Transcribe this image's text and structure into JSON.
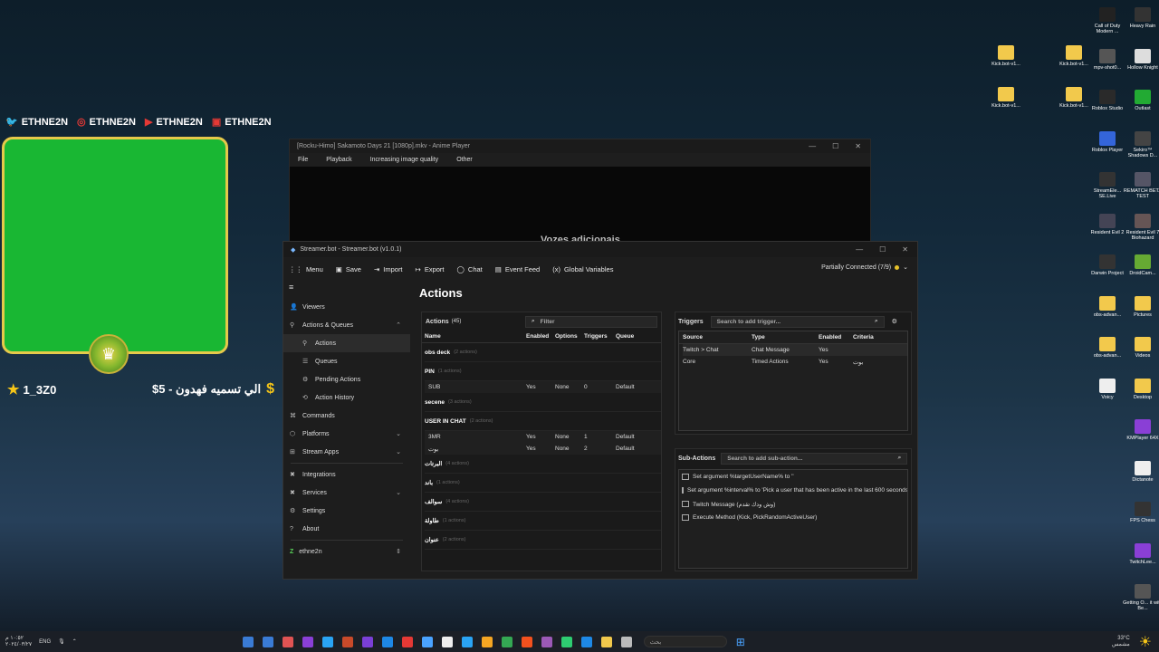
{
  "overlay": {
    "socials": [
      {
        "icon": "twitter-icon",
        "handle": "ETHNE2N",
        "color": "#e53935"
      },
      {
        "icon": "instagram-icon",
        "handle": "ETHNE2N",
        "color": "#e53935"
      },
      {
        "icon": "youtube-icon",
        "handle": "ETHNE2N",
        "color": "#e53935"
      },
      {
        "icon": "twitch-icon",
        "handle": "ETHNE2N",
        "color": "#e53935"
      }
    ],
    "stars_user": "1_3Z0",
    "donation_text": "الي تسميه فهدون - 5$",
    "cam_color": "#19b733"
  },
  "player": {
    "title": "[Rocku-Himo] Sakamoto Days 21 [1080p].mkv - Anime Player",
    "menu": [
      "File",
      "Playback",
      "Increasing image quality",
      "Other"
    ],
    "subtitle": "Vozes adicionais"
  },
  "streamerbot": {
    "title": "Streamer.bot - Streamer.bot (v1.0.1)",
    "toolbar": [
      "Menu",
      "Save",
      "Import",
      "Export",
      "Chat",
      "Event Feed",
      "Global Variables"
    ],
    "connection": "Partially Connected (7/9)",
    "sidebar": [
      {
        "label": "Viewers",
        "icon": "person-icon"
      },
      {
        "label": "Actions & Queues",
        "icon": "actions-icon",
        "expanded": true
      },
      {
        "label": "Actions",
        "icon": "actions-icon",
        "sub": true,
        "active": true
      },
      {
        "label": "Queues",
        "icon": "queue-icon",
        "sub": true
      },
      {
        "label": "Pending Actions",
        "icon": "pending-icon",
        "sub": true
      },
      {
        "label": "Action History",
        "icon": "history-icon",
        "sub": true
      },
      {
        "label": "Commands",
        "icon": "command-icon"
      },
      {
        "label": "Platforms",
        "icon": "platforms-icon",
        "chevron": true
      },
      {
        "label": "Stream Apps",
        "icon": "apps-icon",
        "chevron": true
      },
      {
        "label": "Integrations",
        "icon": "integrations-icon"
      },
      {
        "label": "Services",
        "icon": "services-icon",
        "chevron": true
      },
      {
        "label": "Settings",
        "icon": "gear-icon"
      },
      {
        "label": "About",
        "icon": "info-icon"
      }
    ],
    "user": "ethne2n",
    "heading": "Actions",
    "actions": {
      "label": "Actions",
      "count": "(45)",
      "filter_placeholder": "Filter",
      "columns": [
        "Name",
        "Enabled",
        "Options",
        "Triggers",
        "Queue"
      ],
      "rows": [
        {
          "type": "group",
          "name": "obs deck",
          "meta": "(2 actions)"
        },
        {
          "type": "group",
          "name": "PIN",
          "meta": "(1 actions)"
        },
        {
          "type": "row",
          "name": "SUB",
          "enabled": "Yes",
          "options": "None",
          "triggers": "0",
          "queue": "Default"
        },
        {
          "type": "group",
          "name": "secene",
          "meta": "(3 actions)"
        },
        {
          "type": "group",
          "name": "USER IN CHAT",
          "meta": "(2 actions)"
        },
        {
          "type": "row",
          "name": "3MR",
          "enabled": "Yes",
          "options": "None",
          "triggers": "1",
          "queue": "Default"
        },
        {
          "type": "row",
          "name": "بوت",
          "enabled": "Yes",
          "options": "None",
          "triggers": "2",
          "queue": "Default"
        },
        {
          "type": "group",
          "name": "البرتات",
          "meta": "(4 actions)"
        },
        {
          "type": "group",
          "name": "باند",
          "meta": "(1 actions)"
        },
        {
          "type": "group",
          "name": "سوالف",
          "meta": "(4 actions)"
        },
        {
          "type": "group",
          "name": "طاولة",
          "meta": "(1 actions)"
        },
        {
          "type": "group",
          "name": "عنوان",
          "meta": "(2 actions)"
        }
      ]
    },
    "triggers": {
      "label": "Triggers",
      "search_placeholder": "Search to add trigger...",
      "columns": [
        "Source",
        "Type",
        "Enabled",
        "Criteria"
      ],
      "rows": [
        {
          "source": "Twitch > Chat",
          "type": "Chat Message",
          "enabled": "Yes",
          "criteria": ""
        },
        {
          "source": "Core",
          "type": "Timed Actions",
          "enabled": "Yes",
          "criteria": "بوت"
        }
      ]
    },
    "subactions": {
      "label": "Sub-Actions",
      "search_placeholder": "Search to add sub-action...",
      "rows": [
        "Set argument %targetUserName% to ''",
        "Set argument %interval% to 'Pick a user that has been active in the last 600 seconds'",
        "Twitch Message (وش ودك تقدم)",
        "Execute Method (Kick, PickRandomActiveUser)"
      ]
    }
  },
  "desktop": {
    "icons_col1": [
      {
        "label": "Kick.bot-v1...",
        "color": "#f2c94c"
      },
      {
        "label": "Kick.bot-v1...",
        "color": "#f2c94c"
      }
    ],
    "icons_col2": [
      {
        "label": "Kick.bot-v1...",
        "color": "#f2c94c"
      },
      {
        "label": "Kick.bot-v1...",
        "color": "#f2c94c"
      }
    ],
    "icons_col3": [
      {
        "label": "Call of Duty Modern ...",
        "color": "#222"
      },
      {
        "label": "mpv-shot0...",
        "color": "#555"
      },
      {
        "label": "Roblox Studio",
        "color": "#2a2a2a"
      },
      {
        "label": "Roblox Player",
        "color": "#3465d9"
      },
      {
        "label": "StreamEle... SE.Live",
        "color": "#333"
      },
      {
        "label": "Resident Evil 2",
        "color": "#445"
      },
      {
        "label": "Darwin Project",
        "color": "#333"
      },
      {
        "label": "obs-advan...",
        "color": "#f2c94c"
      },
      {
        "label": "obs-advan...",
        "color": "#f2c94c"
      },
      {
        "label": "Voicy",
        "color": "#eee"
      }
    ],
    "icons_col4": [
      {
        "label": "Heavy Rain",
        "color": "#333"
      },
      {
        "label": "Hollow Knight",
        "color": "#ddd"
      },
      {
        "label": "Outlast",
        "color": "#2a3"
      },
      {
        "label": "Sekiro™ Shadows D...",
        "color": "#444"
      },
      {
        "label": "REMATCH BETA TEST",
        "color": "#556"
      },
      {
        "label": "Resident Evil 7 Biohazard",
        "color": "#655"
      },
      {
        "label": "DroidCam...",
        "color": "#6a3"
      },
      {
        "label": "Pictures",
        "color": "#f2c94c"
      },
      {
        "label": "Videos",
        "color": "#f2c94c"
      },
      {
        "label": "Desktop",
        "color": "#f2c94c"
      },
      {
        "label": "KMPlayer 64X",
        "color": "#8a3fd6"
      },
      {
        "label": "Dictanote",
        "color": "#eee"
      },
      {
        "label": "FPS Chess",
        "color": "#333"
      },
      {
        "label": "TwitchLee...",
        "color": "#8a3fd6"
      },
      {
        "label": "Getting O... it with Be...",
        "color": "#555"
      }
    ]
  },
  "taskbar": {
    "time": "١٠:٥٢ م",
    "date": "٢٠٢٤/٠٣/٢٧",
    "lang": "ENG",
    "search_placeholder": "بحث",
    "weather": "33°C",
    "weather_desc": "مشمس"
  }
}
